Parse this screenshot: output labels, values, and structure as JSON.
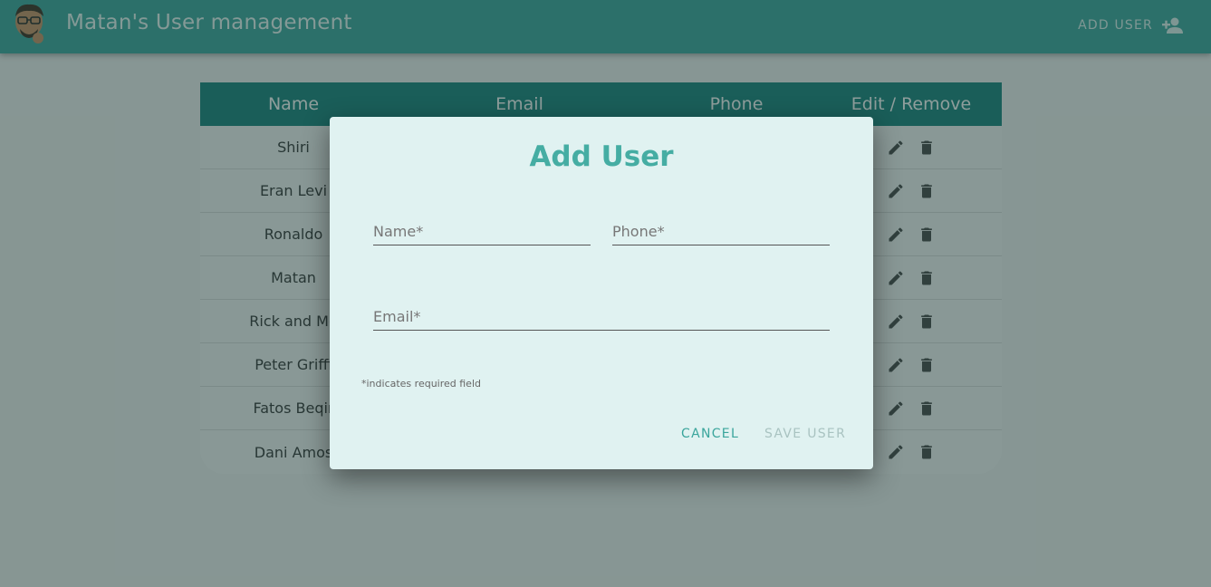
{
  "app": {
    "title": "Matan's User management",
    "add_user_label": "ADD USER"
  },
  "table": {
    "headers": {
      "name": "Name",
      "email": "Email",
      "phone": "Phone",
      "actions": "Edit / Remove"
    },
    "rows": [
      {
        "name": "Shiri"
      },
      {
        "name": "Eran Levi"
      },
      {
        "name": "Ronaldo"
      },
      {
        "name": "Matan"
      },
      {
        "name": "Rick and Mo"
      },
      {
        "name": "Peter Griffi"
      },
      {
        "name": "Fatos Beqir"
      },
      {
        "name": "Dani Amos"
      }
    ]
  },
  "dialog": {
    "title": "Add User",
    "name_placeholder": "Name*",
    "phone_placeholder": "Phone*",
    "email_placeholder": "Email*",
    "required_note": "*indicates required field",
    "cancel_label": "CANCEL",
    "save_label": "SAVE USER"
  },
  "colors": {
    "appbar": "#3aa59c",
    "table_header": "#17807a",
    "accent": "#45ada3"
  },
  "icons": {
    "avatar": "avatar",
    "add_user": "person-add-icon",
    "edit": "pencil-icon",
    "delete": "trash-icon"
  }
}
